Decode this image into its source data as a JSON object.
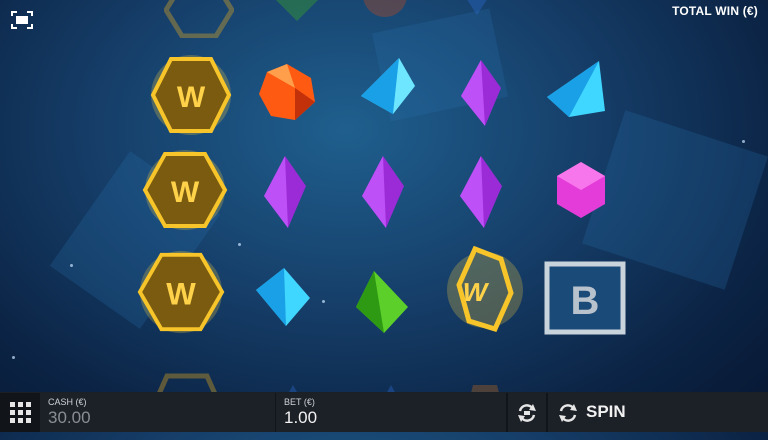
{
  "header": {
    "total_win_label": "TOTAL WIN (€)"
  },
  "reels": [
    {
      "row": "top-partial",
      "symbols": [
        "wild-hex",
        "green-gem",
        "orange-gem",
        "blue-gem",
        "",
        ""
      ]
    },
    {
      "row": "1",
      "symbols": [
        "wild-hex",
        "orange-gem",
        "cyan-gem",
        "purple-gem",
        "cyan-gem"
      ]
    },
    {
      "row": "2",
      "symbols": [
        "wild-hex",
        "purple-gem",
        "purple-gem",
        "purple-gem",
        "pink-gem"
      ]
    },
    {
      "row": "3",
      "symbols": [
        "wild-hex",
        "cyan-gem",
        "green-gem",
        "wild-hex-tilted",
        "bonus-b"
      ]
    }
  ],
  "symbol_text": {
    "wild": "W",
    "bonus": "B"
  },
  "footer": {
    "cash_label": "CASH (€)",
    "cash_value": "30.00",
    "bet_label": "BET (€)",
    "bet_value": "1.00",
    "spin_label": "SPIN"
  },
  "colors": {
    "wild_gold": "#f2b21a",
    "orange_gem": "#ff5a12",
    "cyan_gem": "#3fd6ff",
    "purple_gem": "#9b2bd6",
    "pink_gem": "#e43cd8",
    "green_gem": "#5ccf2a",
    "bar_bg": "#1c2027"
  }
}
